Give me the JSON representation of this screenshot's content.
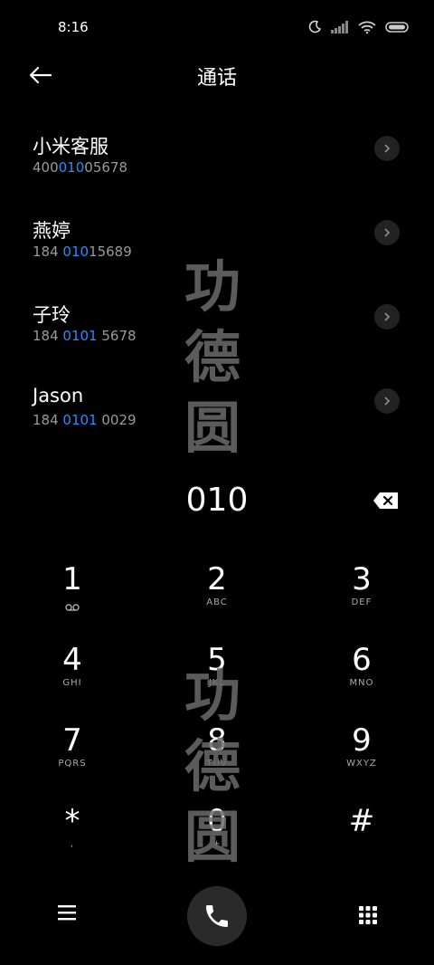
{
  "status": {
    "time": "8:16"
  },
  "header": {
    "title": "通话"
  },
  "contacts": [
    {
      "name": "小米客服",
      "number_pre": "400",
      "number_hl": "010",
      "number_post": "05678"
    },
    {
      "name": "燕婷",
      "number_pre": "184 ",
      "number_hl": "010",
      "number_post": "15689"
    },
    {
      "name": "子玲",
      "number_pre": "184 ",
      "number_hl": "0101",
      "number_post": " 5678"
    },
    {
      "name": "Jason",
      "number_pre": "184 ",
      "number_hl": "0101",
      "number_post": " 0029"
    }
  ],
  "dial": {
    "input": "010"
  },
  "keypad": [
    {
      "num": "1",
      "letters": ""
    },
    {
      "num": "2",
      "letters": "ABC"
    },
    {
      "num": "3",
      "letters": "DEF"
    },
    {
      "num": "4",
      "letters": "GHI"
    },
    {
      "num": "5",
      "letters": "JKL"
    },
    {
      "num": "6",
      "letters": "MNO"
    },
    {
      "num": "7",
      "letters": "PQRS"
    },
    {
      "num": "8",
      "letters": "TUV"
    },
    {
      "num": "9",
      "letters": "WXYZ"
    },
    {
      "num": "*",
      "letters": ","
    },
    {
      "num": "0",
      "letters": "+"
    },
    {
      "num": "#",
      "letters": ""
    }
  ],
  "watermark": {
    "chars": [
      "功",
      "德",
      "圆"
    ]
  },
  "colors": {
    "background": "#000000",
    "highlight": "#1e90ff",
    "button": "#2a2a2a"
  }
}
